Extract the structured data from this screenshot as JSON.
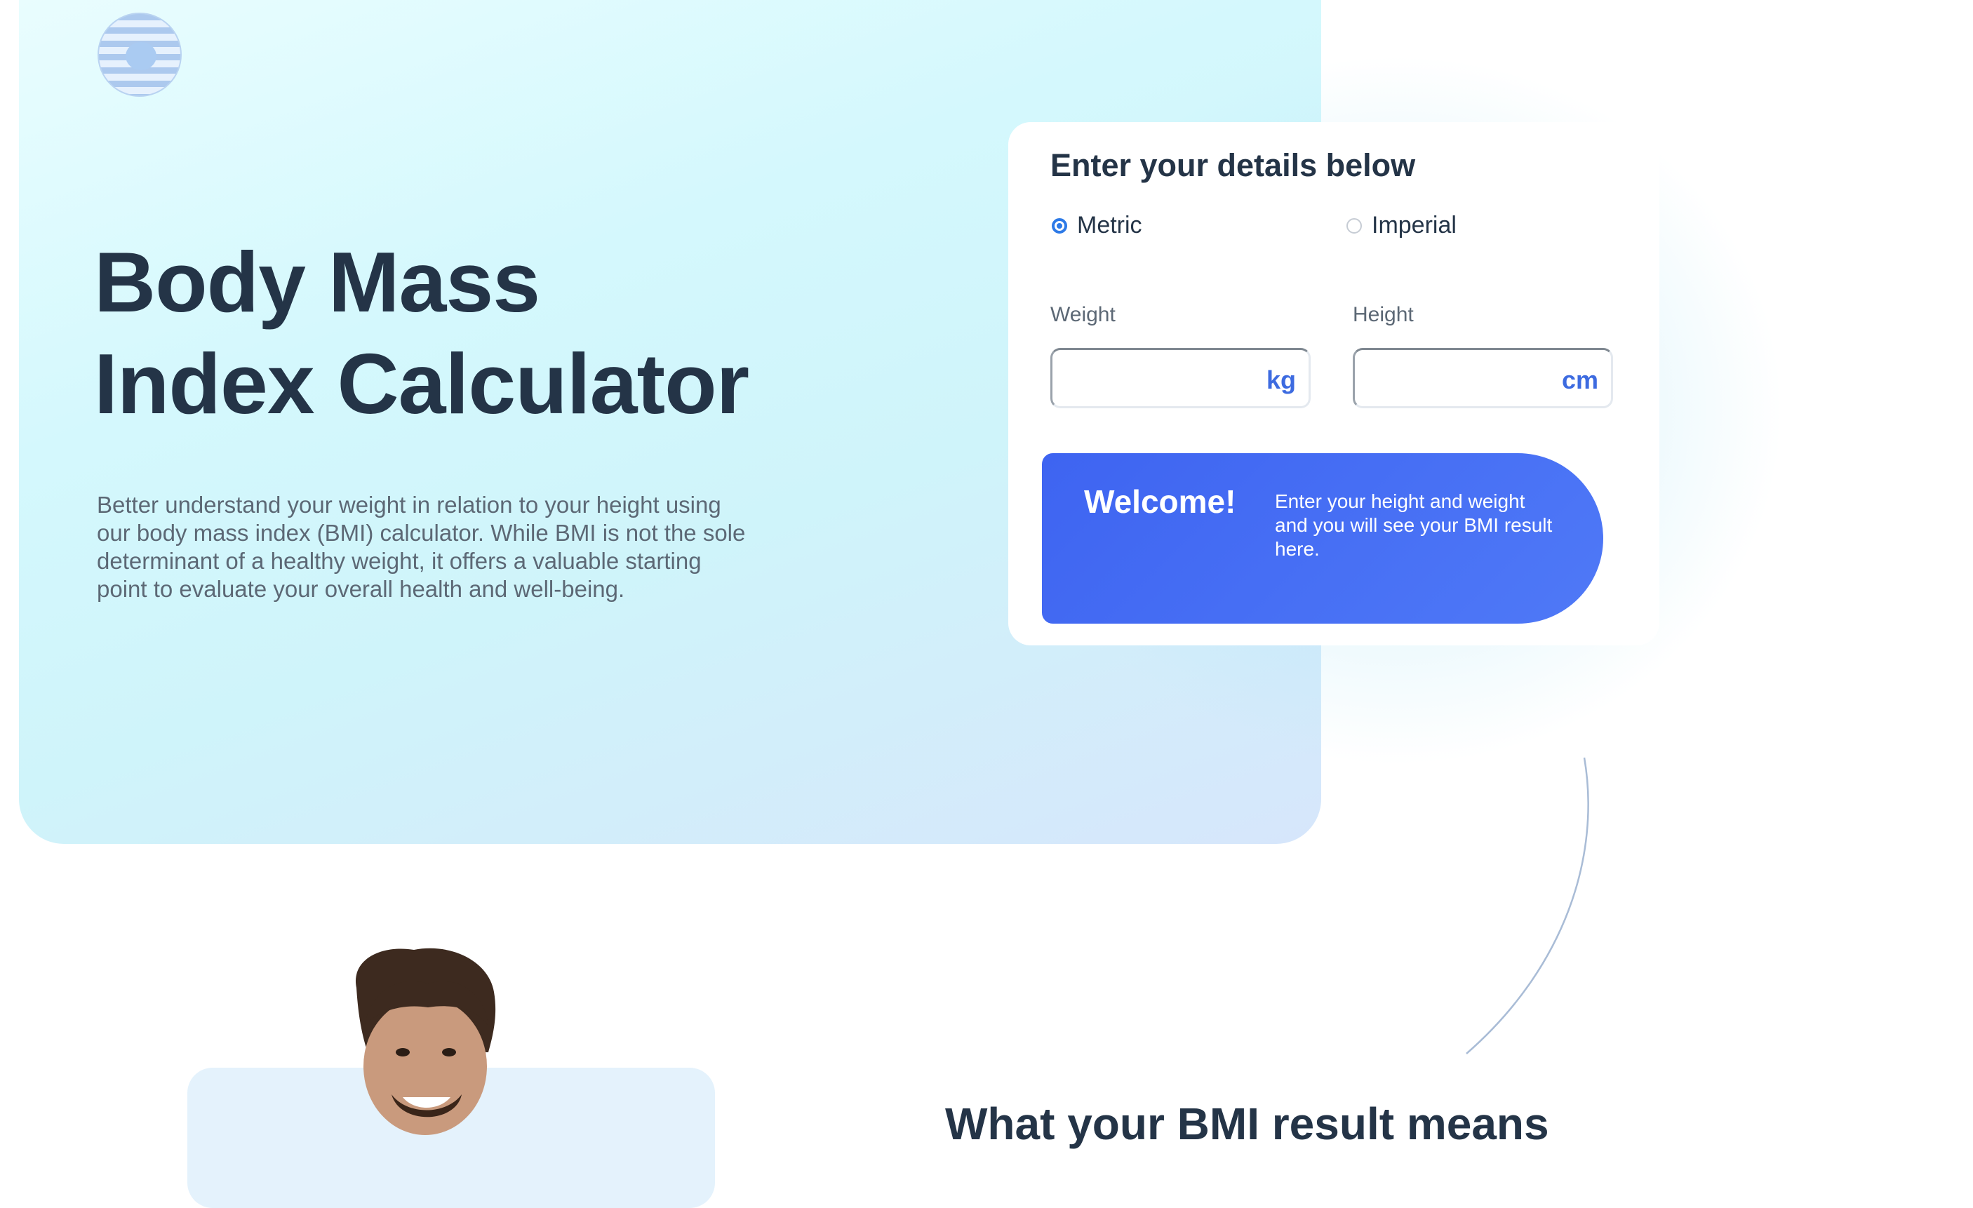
{
  "hero": {
    "title_line1": "Body Mass",
    "title_line2": "Index Calculator",
    "intro_line1": "Better understand your weight in relation to your height using",
    "intro_line2": "our body mass index (BMI) calculator. While BMI is not the sole",
    "intro_line3": "determinant of a healthy weight, it offers a valuable starting",
    "intro_line4": "point to evaluate your overall health and well-being."
  },
  "calculator": {
    "title": "Enter your details below",
    "units": {
      "selected": "Metric",
      "options": [
        "Metric",
        "Imperial"
      ],
      "metric_label": "Metric",
      "imperial_label": "Imperial"
    },
    "weight": {
      "label": "Weight",
      "unit": "kg",
      "value": ""
    },
    "height": {
      "label": "Height",
      "unit": "cm",
      "value": ""
    },
    "result": {
      "heading": "Welcome!",
      "message": "Enter your height and weight and you will see your BMI result here."
    }
  },
  "colors": {
    "accent": "#3e64f1",
    "heading": "#243447",
    "body_text": "#5c6875",
    "unit_text": "#3d6be0",
    "hero_background": "#d4f8fd"
  },
  "icons": {
    "logo": "striped-circle-logo",
    "radio_checked": "radio-selected",
    "radio_unchecked": "radio-empty"
  },
  "results_section": {
    "heading": "What your BMI result means"
  }
}
